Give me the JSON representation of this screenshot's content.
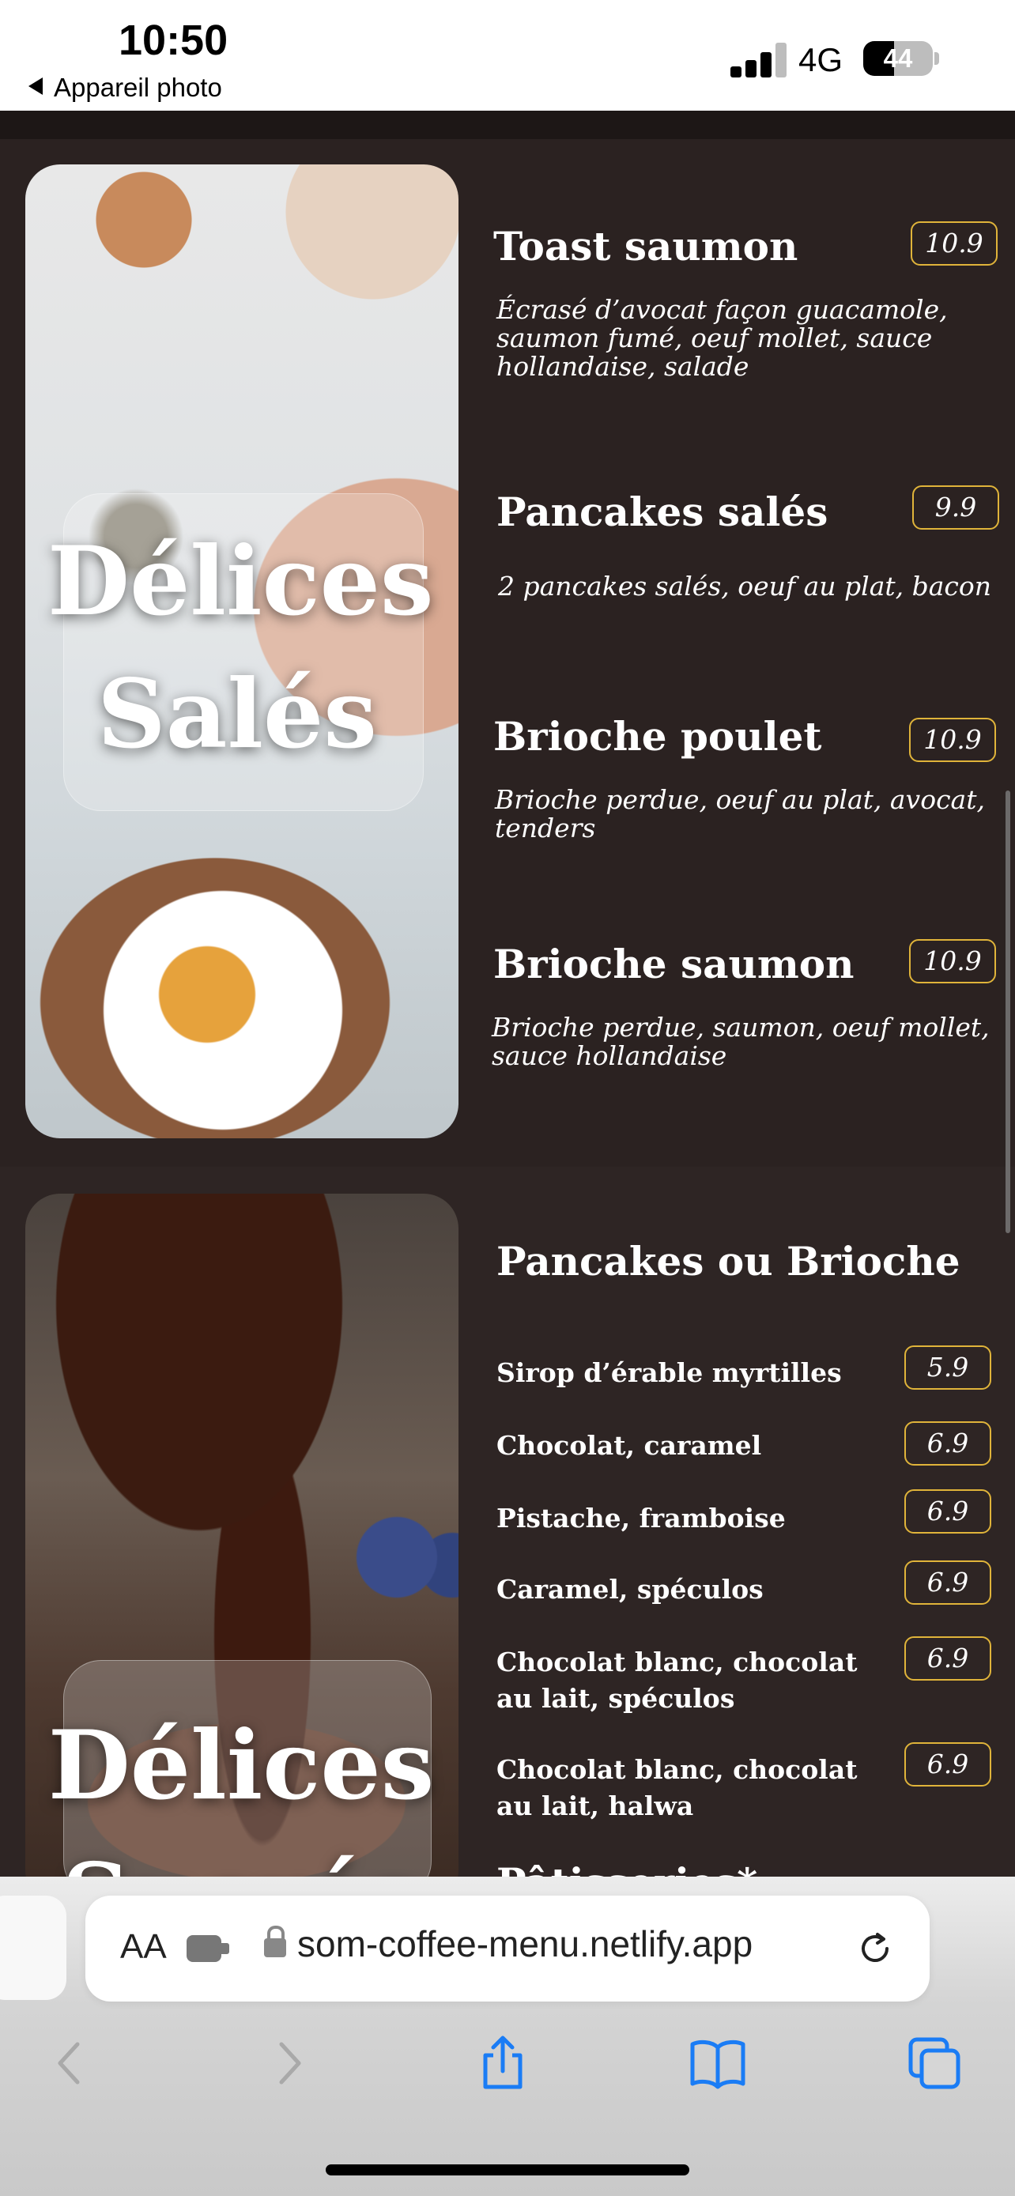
{
  "status_bar": {
    "time": "10:50",
    "back_label": "Appareil photo",
    "network": "4G",
    "battery": "44",
    "battery_level": 0.44
  },
  "sections": {
    "sales": {
      "title_line1": "Délices",
      "title_line2": "Salés",
      "items": [
        {
          "name": "Toast saumon",
          "price": "10.9",
          "description": "Écrasé d’avocat façon guacamole, saumon fumé, oeuf mollet, sauce hollandaise, salade"
        },
        {
          "name": "Pancakes salés",
          "price": "9.9",
          "description": "2 pancakes salés, oeuf au plat, bacon"
        },
        {
          "name": "Brioche poulet",
          "price": "10.9",
          "description": "Brioche perdue, oeuf au plat, avocat, tenders"
        },
        {
          "name": "Brioche saumon",
          "price": "10.9",
          "description": "Brioche perdue, saumon, oeuf mollet, sauce hollandaise"
        }
      ]
    },
    "sucres": {
      "title_line1": "Délices",
      "title_line2": "Sucrés",
      "subtitle": "Pancakes ou Brioche",
      "toppings": [
        {
          "name": "Sirop d’érable myrtilles",
          "price": "5.9"
        },
        {
          "name": "Chocolat, caramel",
          "price": "6.9"
        },
        {
          "name": "Pistache, framboise",
          "price": "6.9"
        },
        {
          "name": "Caramel, spéculos",
          "price": "6.9"
        },
        {
          "name": "Chocolat blanc, chocolat au lait, spéculos",
          "price": "6.9"
        },
        {
          "name": "Chocolat blanc, chocolat au lait, halwa",
          "price": "6.9"
        }
      ],
      "next_heading_partial": "Pâtisseries*"
    }
  },
  "browser": {
    "aa_label": "AA",
    "url": "som-coffee-menu.netlify.app",
    "icons": [
      "text-size-icon",
      "extension-icon",
      "lock-icon",
      "reload-icon",
      "back-icon",
      "forward-icon",
      "share-icon",
      "bookmarks-icon",
      "tabs-icon"
    ]
  },
  "colors": {
    "page_bg": "#2b2221",
    "price_border": "#e0b43a",
    "safari_blue": "#1a7cf5"
  }
}
